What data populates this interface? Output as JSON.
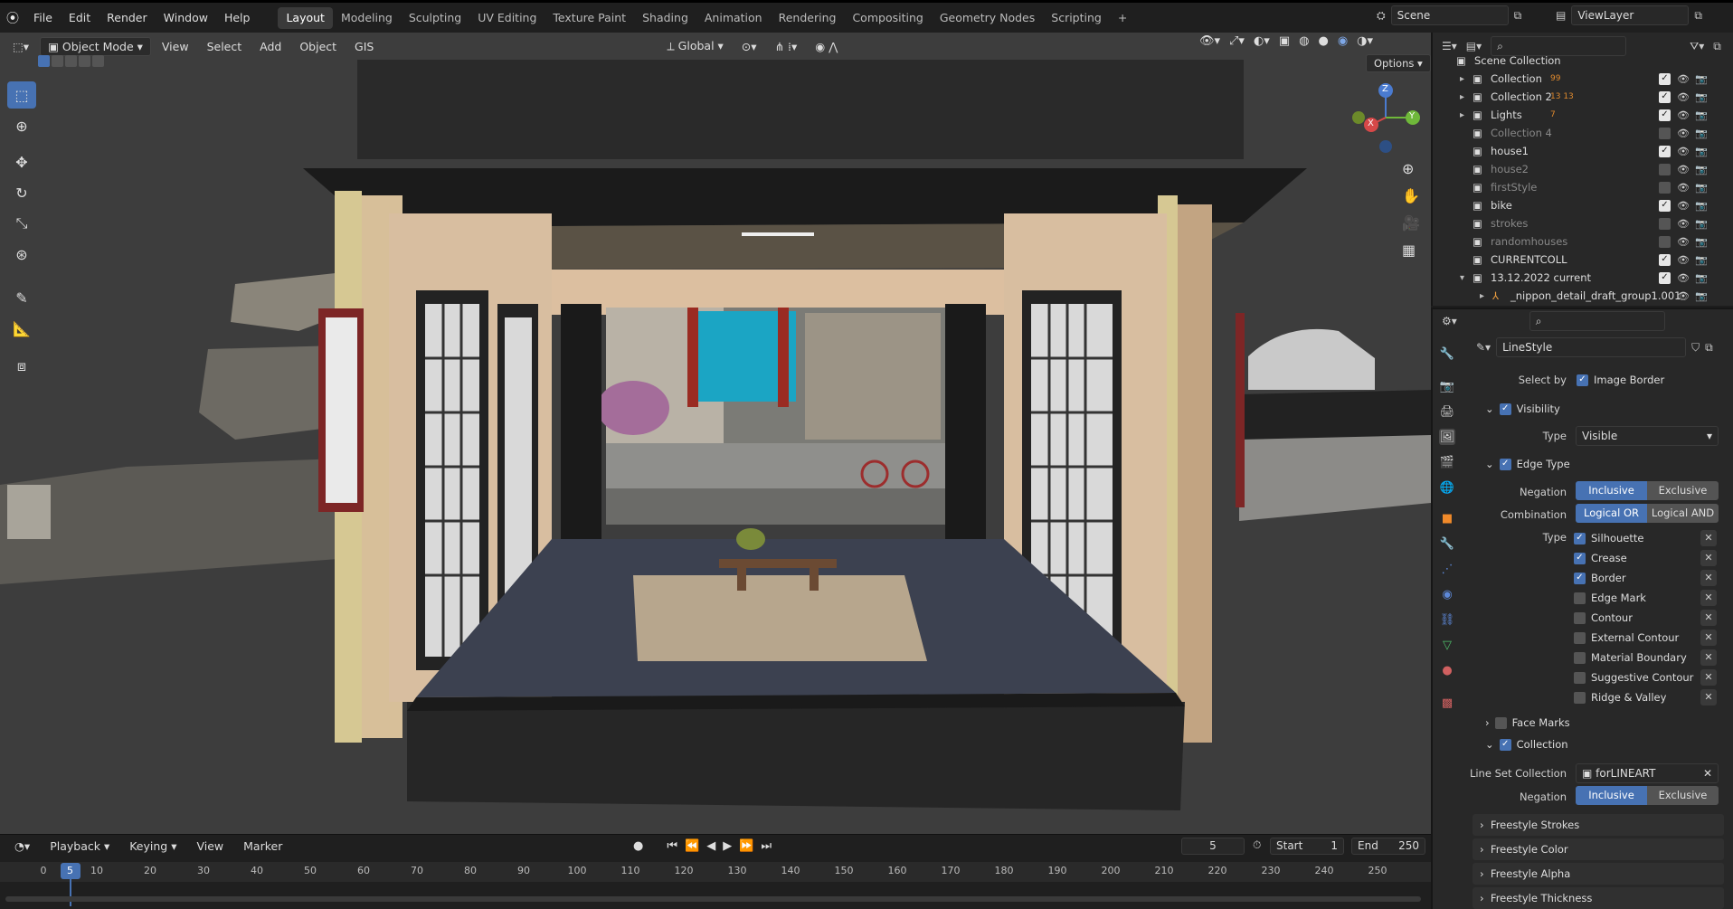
{
  "topbar": {
    "menus": [
      "File",
      "Edit",
      "Render",
      "Window",
      "Help"
    ],
    "workspaces": [
      "Layout",
      "Modeling",
      "Sculpting",
      "UV Editing",
      "Texture Paint",
      "Shading",
      "Animation",
      "Rendering",
      "Compositing",
      "Geometry Nodes",
      "Scripting"
    ],
    "active_workspace": "Layout",
    "add_tab": "+",
    "scene": "Scene",
    "view_layer": "ViewLayer"
  },
  "viewport_header": {
    "mode": "Object Mode",
    "menus": [
      "View",
      "Select",
      "Add",
      "Object",
      "GIS"
    ],
    "orientation": "Global",
    "options": "Options"
  },
  "gizmo": {
    "x": "X",
    "y": "Y",
    "z": "Z"
  },
  "outliner": {
    "root": "Scene Collection",
    "items": [
      {
        "name": "Collection",
        "badges": "99",
        "checked": true,
        "dim": false,
        "expand": "▸"
      },
      {
        "name": "Collection 2",
        "badges": "13 13",
        "checked": true,
        "dim": false,
        "expand": "▸"
      },
      {
        "name": "Lights",
        "badges": "7",
        "checked": true,
        "dim": false,
        "expand": "▸"
      },
      {
        "name": "Collection 4",
        "badges": "",
        "checked": false,
        "dim": true,
        "expand": ""
      },
      {
        "name": "house1",
        "badges": "",
        "checked": true,
        "dim": false,
        "expand": ""
      },
      {
        "name": "house2",
        "badges": "",
        "checked": false,
        "dim": true,
        "expand": ""
      },
      {
        "name": "firstStyle",
        "badges": "",
        "checked": false,
        "dim": true,
        "expand": ""
      },
      {
        "name": "bike",
        "badges": "",
        "checked": true,
        "dim": false,
        "expand": ""
      },
      {
        "name": "strokes",
        "badges": "",
        "checked": false,
        "dim": true,
        "expand": ""
      },
      {
        "name": "randomhouses",
        "badges": "",
        "checked": false,
        "dim": true,
        "expand": ""
      },
      {
        "name": "CURRENTCOLL",
        "badges": "",
        "checked": true,
        "dim": false,
        "expand": ""
      },
      {
        "name": "13.12.2022 current",
        "badges": "",
        "checked": true,
        "dim": false,
        "expand": "▾"
      },
      {
        "name": "_nippon_detail_draft_group1.001",
        "badges": "",
        "checked": null,
        "dim": false,
        "expand": "▸"
      }
    ]
  },
  "properties": {
    "linestyle": "LineStyle",
    "select_by_label": "Select by",
    "image_border": "Image Border",
    "visibility": "Visibility",
    "type_label": "Type",
    "visibility_type": "Visible",
    "edge_type": "Edge Type",
    "negation_label": "Negation",
    "inclusive": "Inclusive",
    "exclusive": "Exclusive",
    "combination_label": "Combination",
    "logical_or": "Logical OR",
    "logical_and": "Logical AND",
    "edge_types": [
      {
        "name": "Silhouette",
        "checked": true
      },
      {
        "name": "Crease",
        "checked": true
      },
      {
        "name": "Border",
        "checked": true
      },
      {
        "name": "Edge Mark",
        "checked": false
      },
      {
        "name": "Contour",
        "checked": false
      },
      {
        "name": "External Contour",
        "checked": false
      },
      {
        "name": "Material Boundary",
        "checked": false
      },
      {
        "name": "Suggestive Contour",
        "checked": false
      },
      {
        "name": "Ridge & Valley",
        "checked": false
      }
    ],
    "face_marks": "Face Marks",
    "collection": "Collection",
    "line_set_collection_label": "Line Set Collection",
    "line_set_collection": "forLINEART",
    "negation2_label": "Negation",
    "panels": [
      "Freestyle Strokes",
      "Freestyle Color",
      "Freestyle Alpha",
      "Freestyle Thickness"
    ]
  },
  "timeline": {
    "menus": [
      "Playback",
      "Keying",
      "View",
      "Marker"
    ],
    "current_frame": "5",
    "start_label": "Start",
    "start": "1",
    "end_label": "End",
    "end": "250",
    "ticks": [
      "0",
      "10",
      "20",
      "30",
      "40",
      "50",
      "60",
      "70",
      "80",
      "90",
      "100",
      "110",
      "120",
      "130",
      "140",
      "150",
      "160",
      "170",
      "180",
      "190",
      "200",
      "210",
      "220",
      "230",
      "240",
      "250"
    ],
    "marker_frame": 5
  }
}
